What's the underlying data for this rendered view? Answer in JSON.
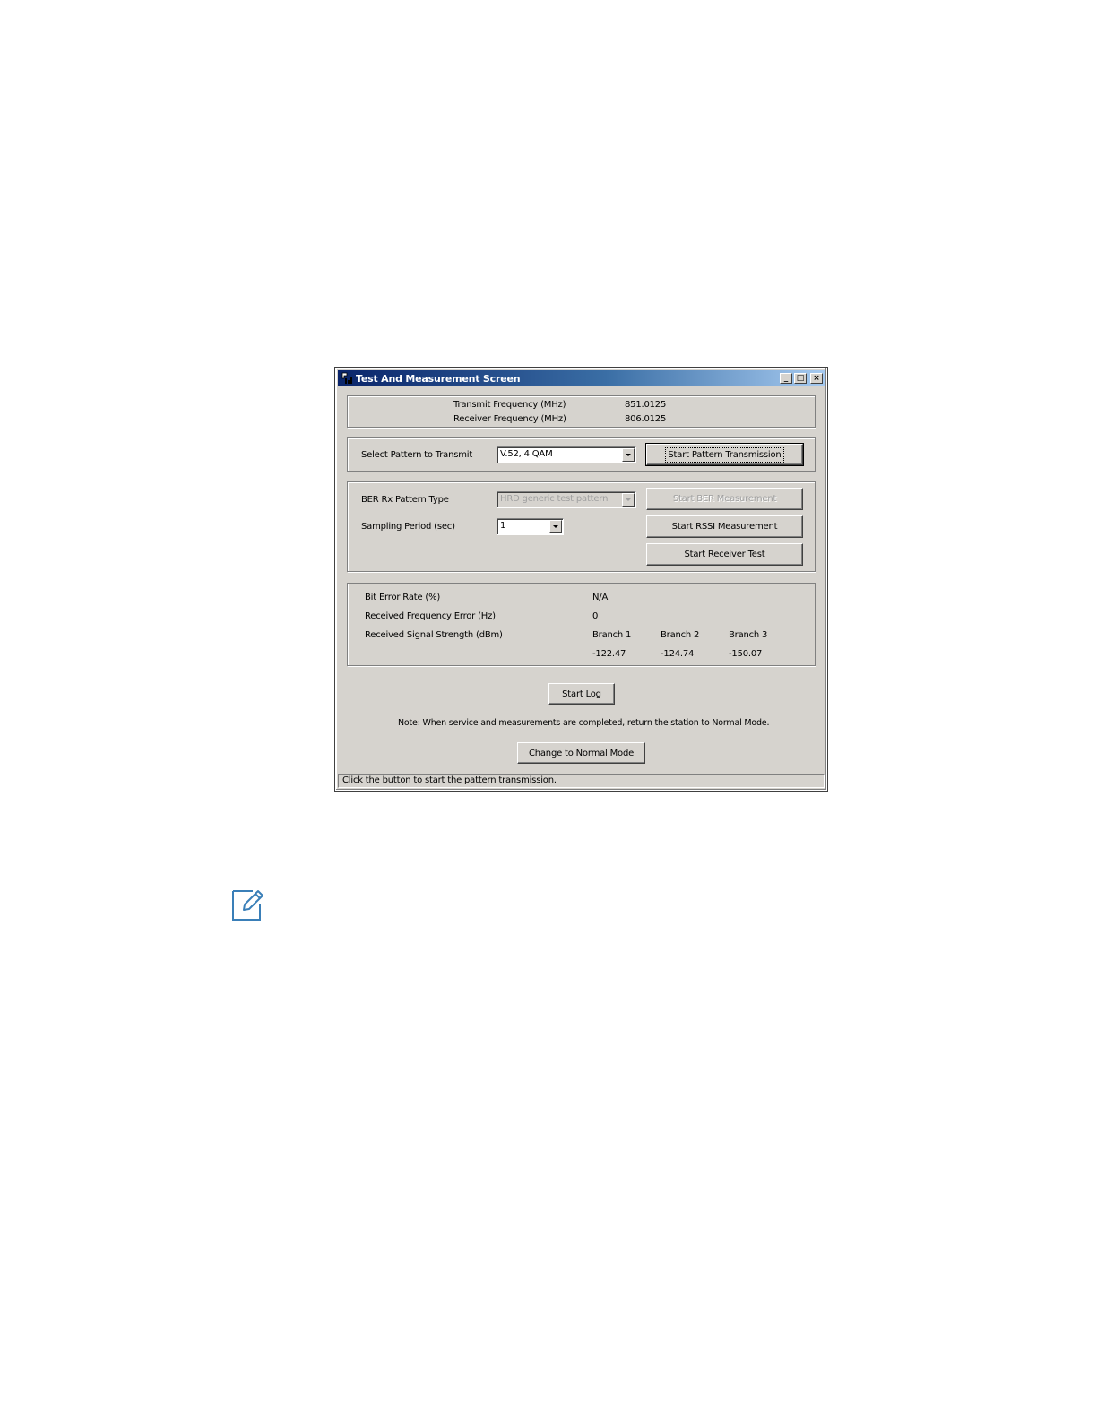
{
  "window": {
    "title": "Test And Measurement Screen",
    "controls": {
      "minimize": "_",
      "maximize": "□",
      "close": "×"
    }
  },
  "frequency": {
    "transmit_label": "Transmit Frequency (MHz)",
    "transmit_value": "851.0125",
    "receiver_label": "Receiver Frequency (MHz)",
    "receiver_value": "806.0125"
  },
  "pattern": {
    "select_label": "Select Pattern to Transmit",
    "selected_value": "V.52, 4 QAM",
    "start_button": "Start Pattern Transmission"
  },
  "ber": {
    "rx_pattern_label": "BER Rx Pattern Type",
    "rx_pattern_value": "HRD generic test pattern",
    "sampling_label": "Sampling Period (sec)",
    "sampling_value": "1",
    "start_ber_button": "Start BER Measurement",
    "start_rssi_button": "Start RSSI Measurement",
    "start_receiver_button": "Start Receiver Test"
  },
  "results": {
    "ber_label": "Bit Error Rate (%)",
    "ber_value": "N/A",
    "freq_error_label": "Received Frequency Error (Hz)",
    "freq_error_value": "0",
    "signal_label": "Received Signal Strength (dBm)",
    "branches": [
      {
        "name": "Branch 1",
        "value": "-122.47"
      },
      {
        "name": "Branch 2",
        "value": "-124.74"
      },
      {
        "name": "Branch 3",
        "value": "-150.07"
      }
    ]
  },
  "actions": {
    "start_log": "Start Log",
    "note": "Note: When service and measurements are completed, return the station to Normal Mode.",
    "normal_mode": "Change to Normal Mode"
  },
  "status_bar": "Click the button to start the pattern transmission.",
  "icons": {
    "note_icon": "pencil-note-icon",
    "note_color": "#3a7fb8"
  }
}
